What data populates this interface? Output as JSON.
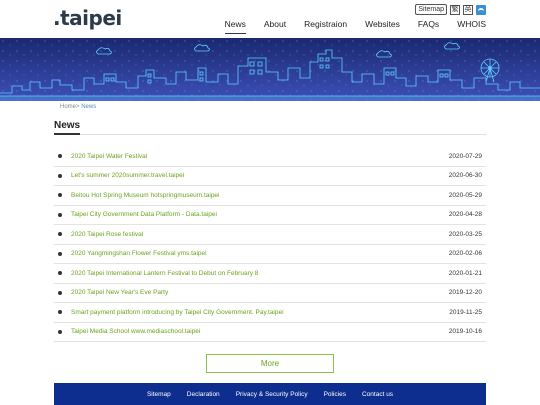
{
  "header": {
    "logo_text": ".taipei",
    "util": {
      "sitemap_label": "Sitemap",
      "btn_a": "繁",
      "btn_b": "英",
      "twitter_icon": "twitter-icon"
    },
    "nav": [
      {
        "label": "News",
        "active": true
      },
      {
        "label": "About"
      },
      {
        "label": "Registraion"
      },
      {
        "label": "Websites"
      },
      {
        "label": "FAQs"
      },
      {
        "label": "WHOIS"
      }
    ]
  },
  "breadcrumb": {
    "home": "Home>",
    "current": "News"
  },
  "page_title": "News",
  "news": [
    {
      "title": "2020 Taipei Water Festival",
      "date": "2020-07-29"
    },
    {
      "title": "Let's summer 2020summer.travel.taipei",
      "date": "2020-06-30"
    },
    {
      "title": "Beitou Hot Spring Museum hotspringmuseum.taipei",
      "date": "2020-05-29"
    },
    {
      "title": "Taipei City Government Data Platform - Data.taipei",
      "date": "2020-04-28"
    },
    {
      "title": "2020 Taipei Rose festival",
      "date": "2020-03-25"
    },
    {
      "title": "2020 Yangmingshan Flower Festival yms.taipei",
      "date": "2020-02-06"
    },
    {
      "title": "2020 Taipei International Lantern Festival to Debut on February 8",
      "date": "2020-01-21"
    },
    {
      "title": "2020 Taipei New Year's Eve Party",
      "date": "2019-12-20"
    },
    {
      "title": "Smart payment platform introducing by Taipei City Government. Pay.taipei",
      "date": "2019-11-25"
    },
    {
      "title": "Taipei Media School www.mediaschool.taipei",
      "date": "2019-10-16"
    }
  ],
  "more_label": "More",
  "footer": {
    "links": [
      "Sitemap",
      "Declaration",
      "Privacy & Security Policy",
      "Policies",
      "Contact us"
    ]
  },
  "colors": {
    "accent_green": "#6aa31e",
    "footer_blue": "#0e2e8f",
    "banner_top": "#1b2a73",
    "banner_bottom": "#3a4bb0",
    "skyline_line": "#5fd0ff"
  }
}
